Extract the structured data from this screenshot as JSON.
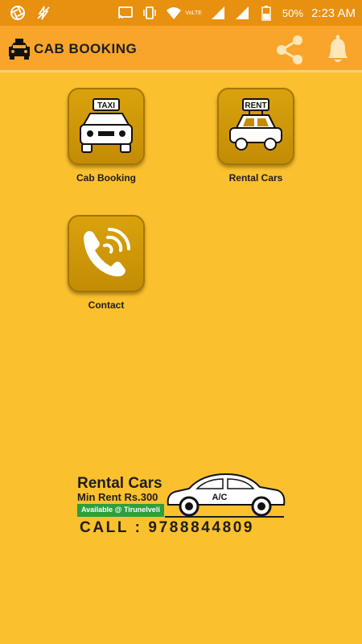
{
  "status_bar": {
    "battery": "50%",
    "time": "2:23 AM",
    "network": "VoLTE",
    "icons": [
      "aperture-icon",
      "bolt-off-icon",
      "cast-icon",
      "vibrate-icon",
      "wifi-icon",
      "signal-icon",
      "battery-icon"
    ]
  },
  "app_bar": {
    "title": "CAB BOOKING",
    "icons": [
      "taxi-logo-icon",
      "share-icon",
      "bell-icon"
    ]
  },
  "menu": {
    "items": [
      {
        "label": "Cab Booking",
        "icon": "taxi-icon"
      },
      {
        "label": "Rental Cars",
        "icon": "rent-car-icon"
      },
      {
        "label": "Contact",
        "icon": "phone-icon"
      }
    ]
  },
  "banner": {
    "title": "Rental Cars",
    "min_rent": "Min Rent Rs.300",
    "availability": "Available @ Tirunelveli",
    "car_tag": "A/C",
    "call": "CALL : 9788844809"
  },
  "colors": {
    "background": "#FBC02D",
    "app_bar": "#F9A52B",
    "status_bar": "#E8900F",
    "tile": "#C48C05",
    "badge_green": "#2E9E3E"
  }
}
